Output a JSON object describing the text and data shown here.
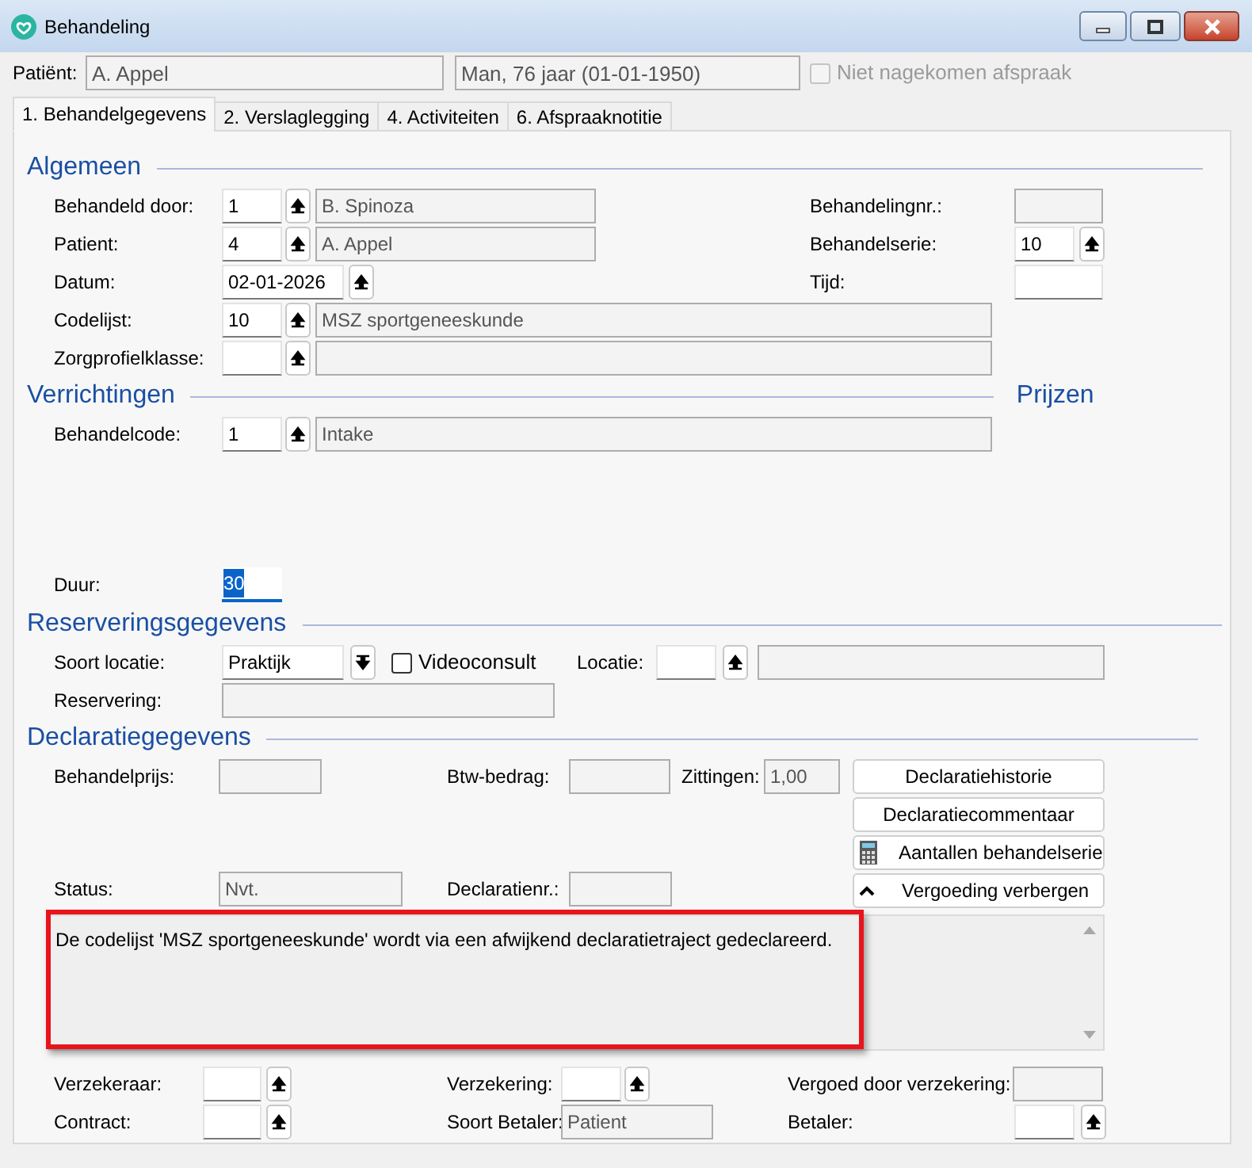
{
  "window": {
    "title": "Behandeling"
  },
  "header": {
    "patient_label": "Patiënt:",
    "patient_name": "A. Appel",
    "patient_info": "Man, 76 jaar (01-01-1950)",
    "no_show": {
      "label": "Niet nagekomen afspraak",
      "checked": false,
      "disabled": true
    }
  },
  "tabs": [
    {
      "label": "1. Behandelgegevens",
      "selected": true
    },
    {
      "label": "2. Verslaglegging",
      "selected": false
    },
    {
      "label": "4. Activiteiten",
      "selected": false
    },
    {
      "label": "6. Afspraaknotitie",
      "selected": false
    }
  ],
  "algemeen": {
    "title": "Algemeen",
    "behandeld_door": {
      "label": "Behandeld door:",
      "code": "1",
      "name": "B. Spinoza"
    },
    "patient": {
      "label": "Patient:",
      "code": "4",
      "name": "A. Appel"
    },
    "datum": {
      "label": "Datum:",
      "value": "02-01-2026"
    },
    "codelijst": {
      "label": "Codelijst:",
      "code": "10",
      "name": "MSZ sportgeneeskunde"
    },
    "zorgprofielklasse": {
      "label": "Zorgprofielklasse:"
    },
    "behandelingnr": {
      "label": "Behandelingnr.:"
    },
    "behandelserie": {
      "label": "Behandelserie:",
      "value": "10"
    },
    "tijd": {
      "label": "Tijd:"
    }
  },
  "verrichtingen": {
    "title": "Verrichtingen",
    "prices_title": "Prijzen",
    "behandelcode": {
      "label": "Behandelcode:",
      "code": "1",
      "name": "Intake"
    },
    "duur": {
      "label": "Duur:",
      "value": "30",
      "text_selected": true
    }
  },
  "reservering": {
    "title": "Reserveringsgegevens",
    "soort_locatie": {
      "label": "Soort locatie:",
      "value": "Praktijk"
    },
    "videoconsult": {
      "label": "Videoconsult",
      "checked": false
    },
    "locatie": {
      "label": "Locatie:"
    },
    "reservering": {
      "label": "Reservering:"
    }
  },
  "declaratie": {
    "title": "Declaratiegegevens",
    "behandelprijs": {
      "label": "Behandelprijs:"
    },
    "btw_bedrag": {
      "label": "Btw-bedrag:"
    },
    "zittingen": {
      "label": "Zittingen:",
      "value": "1,00"
    },
    "status": {
      "label": "Status:",
      "value": "Nvt."
    },
    "declaratienr": {
      "label": "Declaratienr.:"
    },
    "buttons": [
      {
        "label": "Declaratiehistorie",
        "kind": "plain"
      },
      {
        "label": "Declaratiecommentaar",
        "kind": "plain"
      },
      {
        "label": "Aantallen behandelserie",
        "kind": "calculator"
      },
      {
        "label": "Vergoeding verbergen",
        "kind": "collapse"
      }
    ],
    "message": "De codelijst 'MSZ sportgeneeskunde' wordt via een afwijkend declaratietraject gedeclareerd."
  },
  "vergoeding": {
    "verzekeraar": {
      "label": "Verzekeraar:"
    },
    "verzekering": {
      "label": "Verzekering:"
    },
    "vergoed_door_verzekering": {
      "label": "Vergoed door verzekering:"
    },
    "contract": {
      "label": "Contract:"
    },
    "soort_betaler": {
      "label": "Soort Betaler:",
      "value": "Patient"
    },
    "betaler": {
      "label": "Betaler:"
    }
  }
}
